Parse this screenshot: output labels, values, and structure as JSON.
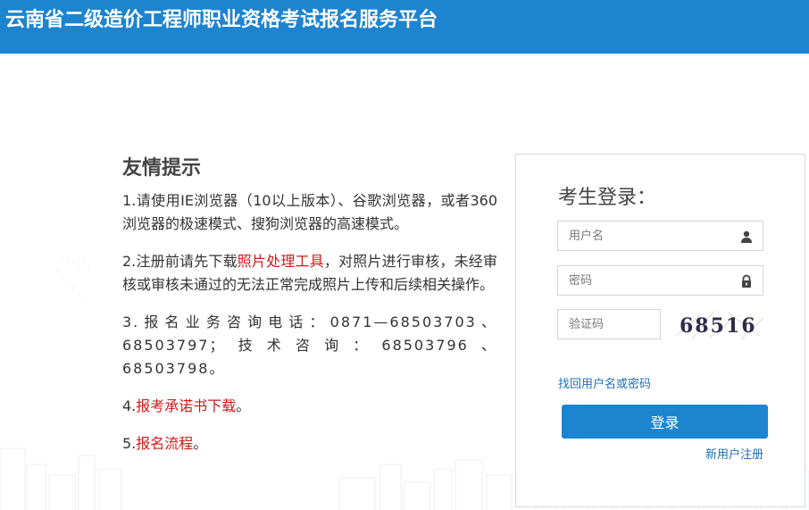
{
  "header": {
    "title": "云南省二级造价工程师职业资格考试报名服务平台"
  },
  "tips": {
    "heading": "友情提示",
    "item1": "1.请使用IE浏览器（10以上版本）、谷歌浏览器，或者360浏览器的极速模式、搜狗浏览器的高速模式。",
    "item2_prefix": "2.注册前请先下载",
    "item2_link": "照片处理工具",
    "item2_suffix": "，对照片进行审核，未经审核或审核未通过的无法正常完成照片上传和后续相关操作。",
    "item3": "3.报名业务咨询电话：0871—68503703、68503797；技术咨询：68503796、68503798。",
    "item4_prefix": "4.",
    "item4_link": "报考承诺书下载",
    "item4_suffix": "。",
    "item5_prefix": "5.",
    "item5_link": "报名流程",
    "item5_suffix": "。"
  },
  "login": {
    "heading": "考生登录：",
    "username_placeholder": "用户名",
    "password_placeholder": "密码",
    "captcha_placeholder": "验证码",
    "captcha_text": "68516",
    "forgot_label": "找回用户名或密码",
    "login_button": "登录",
    "register_label": "新用户注册"
  },
  "icons": {
    "username": "user-icon",
    "password": "lock-icon"
  },
  "colors": {
    "header_bg": "#1d84cf",
    "link_red": "#d11a1a",
    "link_blue": "#1d6fb8",
    "button_bg": "#1d84cf"
  }
}
